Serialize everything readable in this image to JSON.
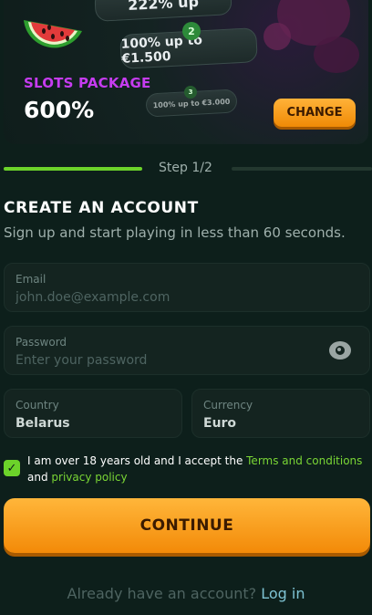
{
  "banner": {
    "pill_top": "222% up",
    "pill_step2": "100% up to €1.500",
    "pill_step3": "100% up to €3.000",
    "step2_number": "2",
    "step3_number": "3",
    "package_label": "SLOTS PACKAGE",
    "package_value": "600%",
    "change_label": "CHANGE"
  },
  "progress": {
    "step_text": "Step 1/2",
    "completed_fraction": 0.5
  },
  "form": {
    "title": "CREATE AN ACCOUNT",
    "subtitle": "Sign up and start playing in less than 60 seconds.",
    "email_label": "Email",
    "email_placeholder": "john.doe@example.com",
    "password_label": "Password",
    "password_placeholder": "Enter your password",
    "country_label": "Country",
    "country_value": "Belarus",
    "currency_label": "Currency",
    "currency_value": "Euro",
    "terms_prefix": "I am over 18 years old and I accept the ",
    "terms_link": "Terms and conditions",
    "terms_and": " and ",
    "privacy_link": "privacy policy",
    "terms_checked": true,
    "continue_label": "CONTINUE",
    "login_prompt": "Already have an account? ",
    "login_link": "Log in"
  },
  "colors": {
    "accent_green": "#6cd32a",
    "accent_orange": "#f39a1a",
    "package_purple": "#c63cf0",
    "background": "#0d1f1b"
  },
  "icons": {
    "banner_art": "watermelon-icon",
    "password_toggle": "eye-icon",
    "checkbox": "checkmark-icon"
  }
}
